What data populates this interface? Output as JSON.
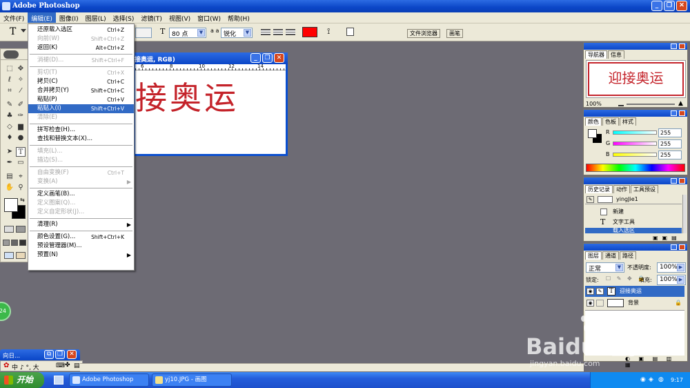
{
  "window": {
    "title": "Adobe Photoshop"
  },
  "menubar": [
    "文件(F)",
    "编辑(E)",
    "图像(I)",
    "图层(L)",
    "选择(S)",
    "滤镜(T)",
    "视图(V)",
    "窗口(W)",
    "帮助(H)"
  ],
  "options": {
    "tool_glyph": "T",
    "font_size": "80 点",
    "aa_label": "a a",
    "antialias": "锐化",
    "text_color": "#ff0000",
    "tab_file_browser": "文件浏览器",
    "tab_brushes": "画笔"
  },
  "edit_menu": [
    {
      "label": "还原载入选区",
      "shortcut": "Ctrl+Z",
      "disabled": false
    },
    {
      "label": "向前(W)",
      "shortcut": "Shift+Ctrl+Z",
      "disabled": true
    },
    {
      "label": "返回(K)",
      "shortcut": "Alt+Ctrl+Z",
      "disabled": false
    },
    {
      "sep": true
    },
    {
      "label": "消褪(D)...",
      "shortcut": "Shift+Ctrl+F",
      "disabled": true
    },
    {
      "sep": true
    },
    {
      "label": "剪切(T)",
      "shortcut": "Ctrl+X",
      "disabled": true
    },
    {
      "label": "拷贝(C)",
      "shortcut": "Ctrl+C",
      "disabled": false
    },
    {
      "label": "合并拷贝(Y)",
      "shortcut": "Shift+Ctrl+C",
      "disabled": false
    },
    {
      "label": "粘贴(P)",
      "shortcut": "Ctrl+V",
      "disabled": false
    },
    {
      "label": "粘贴入(I)",
      "shortcut": "Shift+Ctrl+V",
      "disabled": false,
      "highlight": true
    },
    {
      "label": "清除(E)",
      "shortcut": "",
      "disabled": true
    },
    {
      "sep": true
    },
    {
      "label": "拼写检查(H)...",
      "shortcut": "",
      "disabled": false
    },
    {
      "label": "查找和替换文本(X)...",
      "shortcut": "",
      "disabled": false
    },
    {
      "sep": true
    },
    {
      "label": "填充(L)...",
      "shortcut": "",
      "disabled": true
    },
    {
      "label": "描边(S)...",
      "shortcut": "",
      "disabled": true
    },
    {
      "sep": true
    },
    {
      "label": "自由变换(F)",
      "shortcut": "Ctrl+T",
      "disabled": true
    },
    {
      "label": "变换(A)",
      "shortcut": "",
      "disabled": true,
      "submenu": true
    },
    {
      "sep": true
    },
    {
      "label": "定义画笔(B)...",
      "shortcut": "",
      "disabled": false
    },
    {
      "label": "定义图案(Q)...",
      "shortcut": "",
      "disabled": true
    },
    {
      "label": "定义自定形状(J)...",
      "shortcut": "",
      "disabled": true
    },
    {
      "sep": true
    },
    {
      "label": "清理(R)",
      "shortcut": "",
      "disabled": false,
      "submenu": true
    },
    {
      "sep": true
    },
    {
      "label": "颜色设置(G)...",
      "shortcut": "Shift+Ctrl+K",
      "disabled": false
    },
    {
      "label": "预设管理器(M)...",
      "shortcut": "",
      "disabled": false
    },
    {
      "label": "预置(N)",
      "shortcut": "",
      "disabled": false,
      "submenu": true
    }
  ],
  "document": {
    "title": "接奥运, RGB)",
    "ruler_ticks": [
      "6",
      "8",
      "10",
      "12",
      "14"
    ],
    "canvas_text": "接奥运"
  },
  "navigator": {
    "tabs": [
      "导航器",
      "信息"
    ],
    "preview_text": "迎接奥运",
    "zoom": "100%"
  },
  "color": {
    "tabs": [
      "颜色",
      "色板",
      "样式"
    ],
    "channels": [
      {
        "label": "R",
        "value": "255"
      },
      {
        "label": "G",
        "value": "255"
      },
      {
        "label": "B",
        "value": "255"
      }
    ]
  },
  "history": {
    "tabs": [
      "历史记录",
      "动作",
      "工具预设"
    ],
    "snapshot": "yingJie1",
    "items": [
      "新建",
      "文字工具",
      "载入选区"
    ]
  },
  "layers": {
    "tabs": [
      "图层",
      "通道",
      "路径"
    ],
    "blend_mode": "正常",
    "opacity_label": "不透明度:",
    "opacity": "100%",
    "lock_label": "锁定:",
    "fill_label": "填充:",
    "fill": "100%",
    "items": [
      "迎接奥运",
      "背景"
    ]
  },
  "mini_window": {
    "title": "向日..."
  },
  "ime_bar": {
    "text": "中 ♪ °, 大"
  },
  "badge": "24",
  "taskbar": {
    "start": "开始",
    "buttons": [
      "Adobe Photoshop",
      "yj10.JPG - 画图"
    ],
    "time": "9:17"
  },
  "watermark": {
    "brand": "Baidu 经验",
    "url": "jingyan.baidu.com"
  }
}
